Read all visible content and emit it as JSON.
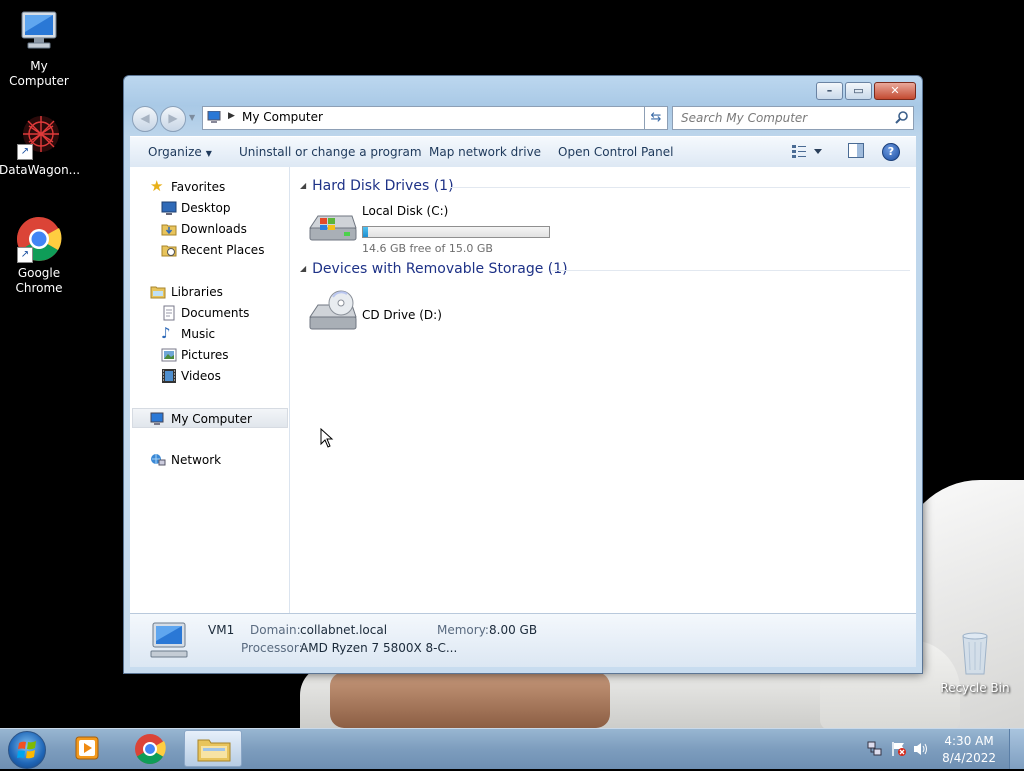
{
  "desktop": {
    "icons": [
      {
        "label": "My Computer"
      },
      {
        "label": "DataWagon..."
      },
      {
        "label": "Google Chrome"
      },
      {
        "label": "Recycle Bin"
      }
    ]
  },
  "window": {
    "address": {
      "crumb": "My Computer"
    },
    "search": {
      "placeholder": "Search My Computer"
    },
    "toolbar": {
      "organize": "Organize",
      "uninstall": "Uninstall or change a program",
      "map_drive": "Map network drive",
      "control_panel": "Open Control Panel"
    },
    "nav": {
      "favorites": "Favorites",
      "desktop": "Desktop",
      "downloads": "Downloads",
      "recent": "Recent Places",
      "libraries": "Libraries",
      "documents": "Documents",
      "music": "Music",
      "pictures": "Pictures",
      "videos": "Videos",
      "computer": "My Computer",
      "network": "Network"
    },
    "groups": {
      "hdd": "Hard Disk Drives (1)",
      "removable": "Devices with Removable Storage (1)"
    },
    "drives": {
      "c_label": "Local Disk (C:)",
      "c_free": "14.6 GB free of 15.0 GB",
      "c_used_fraction": 0.027,
      "d_label": "CD Drive (D:)"
    },
    "details": {
      "name": "VM1",
      "domain_key": "Domain:",
      "domain_val": "collabnet.local",
      "memory_key": "Memory:",
      "memory_val": "8.00 GB",
      "processor_key": "Processor:",
      "processor_val": "AMD Ryzen 7 5800X 8-C..."
    }
  },
  "taskbar": {
    "time": "4:30 AM",
    "date": "8/4/2022"
  }
}
